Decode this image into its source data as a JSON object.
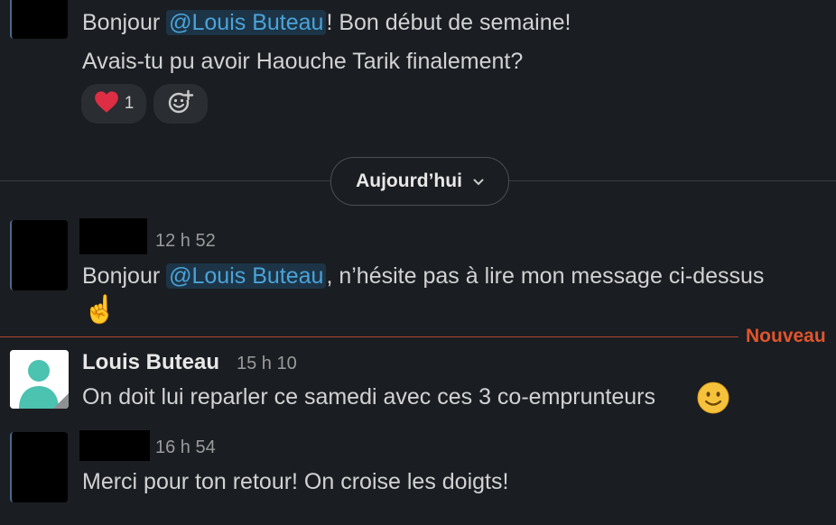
{
  "messages": [
    {
      "line1_before": "Bonjour ",
      "line1_mention": "@Louis Buteau",
      "line1_after": "! Bon début de semaine!",
      "line2": "Avais-tu pu avoir Haouche Tarik finalement?",
      "reactions": [
        {
          "emoji": "❤️",
          "icon": "heart-icon",
          "count": "1"
        },
        {
          "icon": "add-reaction-icon"
        }
      ]
    },
    {
      "time": "12 h 52",
      "text_before": "Bonjour ",
      "mention": "@Louis Buteau",
      "text_after": ", n’hésite pas à lire mon message ci-dessus",
      "emoji": "☝️",
      "emoji_icon": "pointing-up-icon"
    },
    {
      "author": "Louis Buteau",
      "time": "15 h 10",
      "text": "On doit lui reparler ce samedi avec ces 3 co-emprunteurs",
      "emoji": "🙂",
      "emoji_icon": "smiling-face-icon"
    },
    {
      "time": "16 h 54",
      "text": "Merci pour ton retour! On croise les doigts!"
    }
  ],
  "date_divider": {
    "label": "Aujourd’hui",
    "icon": "chevron-down-icon"
  },
  "new_divider": {
    "label": "Nouveau"
  },
  "colors": {
    "background": "#1a1d21",
    "mention_bg": "#1d3446",
    "mention_text": "#4aa3d9",
    "new_accent": "#e0552d",
    "avatar_teal": "#4cc2b0"
  }
}
